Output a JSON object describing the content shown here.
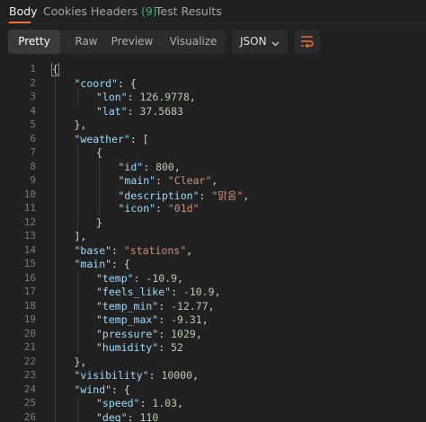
{
  "tabs": [
    {
      "label": "Body",
      "active": true
    },
    {
      "label": "Cookies",
      "active": false
    },
    {
      "label": "Headers",
      "count": "(9)",
      "active": false
    },
    {
      "label": "Test Results",
      "active": false
    }
  ],
  "view_modes": [
    "Pretty",
    "Raw",
    "Preview",
    "Visualize"
  ],
  "active_view_mode": "Pretty",
  "format": "JSON",
  "icons": {
    "format_dropdown": "chevron-down-icon",
    "wrap": "wrap-lines-icon"
  },
  "colors": {
    "accent": "#ff6c37",
    "count": "#3bb36a",
    "key": "#9cdcfe",
    "string": "#ce9178",
    "number": "#b5cea8"
  },
  "lines": [
    {
      "n": "1",
      "tokens": [
        [
          "punct",
          "{"
        ]
      ]
    },
    {
      "n": "2",
      "tokens": [
        [
          "key",
          "\"coord\""
        ],
        [
          "punct",
          ": {"
        ]
      ]
    },
    {
      "n": "3",
      "tokens": [
        [
          "key",
          "\"lon\""
        ],
        [
          "punct",
          ": "
        ],
        [
          "num",
          "126.9778"
        ],
        [
          "punct",
          ","
        ]
      ]
    },
    {
      "n": "4",
      "tokens": [
        [
          "key",
          "\"lat\""
        ],
        [
          "punct",
          ": "
        ],
        [
          "num",
          "37.5683"
        ]
      ]
    },
    {
      "n": "5",
      "tokens": [
        [
          "punct",
          "},"
        ]
      ]
    },
    {
      "n": "6",
      "tokens": [
        [
          "key",
          "\"weather\""
        ],
        [
          "punct",
          ": ["
        ]
      ]
    },
    {
      "n": "7",
      "tokens": [
        [
          "punct",
          "{"
        ]
      ]
    },
    {
      "n": "8",
      "tokens": [
        [
          "key",
          "\"id\""
        ],
        [
          "punct",
          ": "
        ],
        [
          "num",
          "800"
        ],
        [
          "punct",
          ","
        ]
      ]
    },
    {
      "n": "9",
      "tokens": [
        [
          "key",
          "\"main\""
        ],
        [
          "punct",
          ": "
        ],
        [
          "str",
          "\"Clear\""
        ],
        [
          "punct",
          ","
        ]
      ]
    },
    {
      "n": "10",
      "tokens": [
        [
          "key",
          "\"description\""
        ],
        [
          "punct",
          ": "
        ],
        [
          "str",
          "\"맑음\""
        ],
        [
          "punct",
          ","
        ]
      ]
    },
    {
      "n": "11",
      "tokens": [
        [
          "key",
          "\"icon\""
        ],
        [
          "punct",
          ": "
        ],
        [
          "str",
          "\"01d\""
        ]
      ]
    },
    {
      "n": "12",
      "tokens": [
        [
          "punct",
          "}"
        ]
      ]
    },
    {
      "n": "13",
      "tokens": [
        [
          "punct",
          "],"
        ]
      ]
    },
    {
      "n": "14",
      "tokens": [
        [
          "key",
          "\"base\""
        ],
        [
          "punct",
          ": "
        ],
        [
          "str",
          "\"stations\""
        ],
        [
          "punct",
          ","
        ]
      ]
    },
    {
      "n": "15",
      "tokens": [
        [
          "key",
          "\"main\""
        ],
        [
          "punct",
          ": {"
        ]
      ]
    },
    {
      "n": "16",
      "tokens": [
        [
          "key",
          "\"temp\""
        ],
        [
          "punct",
          ": "
        ],
        [
          "num",
          "-10.9"
        ],
        [
          "punct",
          ","
        ]
      ]
    },
    {
      "n": "17",
      "tokens": [
        [
          "key",
          "\"feels_like\""
        ],
        [
          "punct",
          ": "
        ],
        [
          "num",
          "-10.9"
        ],
        [
          "punct",
          ","
        ]
      ]
    },
    {
      "n": "18",
      "tokens": [
        [
          "key",
          "\"temp_min\""
        ],
        [
          "punct",
          ": "
        ],
        [
          "num",
          "-12.77"
        ],
        [
          "punct",
          ","
        ]
      ]
    },
    {
      "n": "19",
      "tokens": [
        [
          "key",
          "\"temp_max\""
        ],
        [
          "punct",
          ": "
        ],
        [
          "num",
          "-9.31"
        ],
        [
          "punct",
          ","
        ]
      ]
    },
    {
      "n": "20",
      "tokens": [
        [
          "key",
          "\"pressure\""
        ],
        [
          "punct",
          ": "
        ],
        [
          "num",
          "1029"
        ],
        [
          "punct",
          ","
        ]
      ]
    },
    {
      "n": "21",
      "tokens": [
        [
          "key",
          "\"humidity\""
        ],
        [
          "punct",
          ": "
        ],
        [
          "num",
          "52"
        ]
      ]
    },
    {
      "n": "22",
      "tokens": [
        [
          "punct",
          "},"
        ]
      ]
    },
    {
      "n": "23",
      "tokens": [
        [
          "key",
          "\"visibility\""
        ],
        [
          "punct",
          ": "
        ],
        [
          "num",
          "10000"
        ],
        [
          "punct",
          ","
        ]
      ]
    },
    {
      "n": "24",
      "tokens": [
        [
          "key",
          "\"wind\""
        ],
        [
          "punct",
          ": {"
        ]
      ]
    },
    {
      "n": "25",
      "tokens": [
        [
          "key",
          "\"speed\""
        ],
        [
          "punct",
          ": "
        ],
        [
          "num",
          "1.03"
        ],
        [
          "punct",
          ","
        ]
      ]
    },
    {
      "n": "26",
      "tokens": [
        [
          "key",
          "\"deg\""
        ],
        [
          "punct",
          ": "
        ],
        [
          "num",
          "110"
        ]
      ]
    }
  ]
}
